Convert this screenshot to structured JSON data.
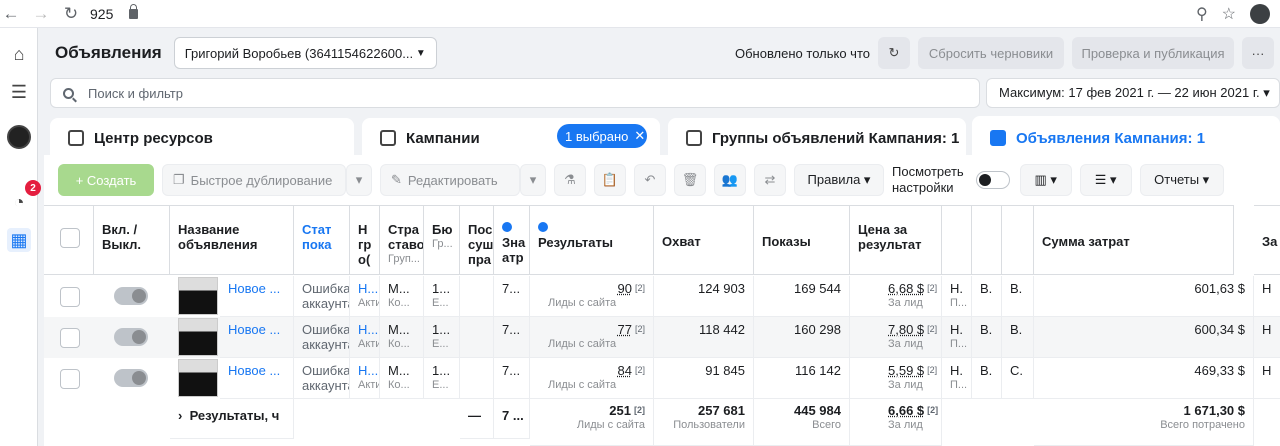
{
  "browser": {
    "url": "925"
  },
  "rail": {
    "notif_count": "2"
  },
  "header": {
    "title": "Объявления",
    "account": "Григорий Воробьев (3641154622600...",
    "updated": "Обновлено только что",
    "reset_label": "Сбросить черновики",
    "publish_label": "Проверка и публикация",
    "more_label": "···"
  },
  "search": {
    "placeholder": "Поиск и фильтр"
  },
  "date_range": "Максимум: 17 фев 2021 г. — 22 июн 2021 г. ▾",
  "tabs": {
    "resources": "Центр ресурсов",
    "campaigns": "Кампании",
    "campaigns_selected": "1 выбрано",
    "adsets": "Группы объявлений Кампания: 1",
    "ads": "Объявления Кампания: 1"
  },
  "toolbar": {
    "create": "+ Создать",
    "duplicate": "Быстрое дублирование",
    "edit": "Редактировать",
    "rules": "Правила ▾",
    "view_settings_1": "Посмотреть",
    "view_settings_2": "настройки",
    "reports": "Отчеты ▾"
  },
  "columns": {
    "onoff_1": "Вкл. /",
    "onoff_2": "Выкл.",
    "name_1": "Название",
    "name_2": "объявления",
    "status_1": "Стат",
    "status_2": "пока",
    "c3_1": "Н",
    "c3_2": "гр",
    "c3_3": "о(",
    "strategy_1": "Стра",
    "strategy_2": "ставо",
    "strategy_sub": "Груп...",
    "budget_1": "Бю",
    "budget_sub": "Гр...",
    "c6_1": "Пос",
    "c6_2": "суш",
    "c6_3": "пра",
    "c7_1": "Зна",
    "c7_2": "атр",
    "results": "Результаты",
    "reach": "Охват",
    "impressions": "Показы",
    "cpr_1": "Цена за",
    "cpr_2": "результат",
    "spent": "Сумма затрат",
    "last": "За"
  },
  "rows": [
    {
      "name": "Новое ...",
      "status": "Ошибка",
      "status2": "аккаунта",
      "c3": "Н...",
      "c3s": "Актив",
      "strat": "М...",
      "strats": "Ко...",
      "budget": "1...",
      "budgets": "Е...",
      "c7": "7...",
      "results": "90",
      "results_sub": "Лиды с сайта",
      "reach": "124 903",
      "impressions": "169 544",
      "cpr": "6,68 $",
      "cpr_sub": "За лид",
      "e1": "Н.",
      "e1s": "П...",
      "e2": "В.",
      "e3": "В.",
      "spent": "601,63 $",
      "z": "Н"
    },
    {
      "name": "Новое ...",
      "status": "Ошибка",
      "status2": "аккаунта",
      "c3": "Н...",
      "c3s": "Актив",
      "strat": "М...",
      "strats": "Ко...",
      "budget": "1...",
      "budgets": "Е...",
      "c7": "7...",
      "results": "77",
      "results_sub": "Лиды с сайта",
      "reach": "118 442",
      "impressions": "160 298",
      "cpr": "7,80 $",
      "cpr_sub": "За лид",
      "e1": "Н.",
      "e1s": "П...",
      "e2": "В.",
      "e3": "В.",
      "spent": "600,34 $",
      "z": "Н"
    },
    {
      "name": "Новое ...",
      "status": "Ошибка",
      "status2": "аккаунта",
      "c3": "Н...",
      "c3s": "Актив",
      "strat": "М...",
      "strats": "Ко...",
      "budget": "1...",
      "budgets": "Е...",
      "c7": "7...",
      "results": "84",
      "results_sub": "Лиды с сайта",
      "reach": "91 845",
      "impressions": "116 142",
      "cpr": "5,59 $",
      "cpr_sub": "За лид",
      "e1": "Н.",
      "e1s": "П...",
      "e2": "В.",
      "e3": "С.",
      "spent": "469,33 $",
      "z": "Н"
    }
  ],
  "totals": {
    "label": "Результаты, ч",
    "c6": "—",
    "c7": "7 ...",
    "results": "251",
    "results_sub": "Лиды с сайта",
    "reach": "257 681",
    "reach_sub": "Пользователи",
    "impressions": "445 984",
    "impressions_sub": "Всего",
    "cpr": "6,66 $",
    "cpr_sub": "За лид",
    "spent": "1 671,30 $",
    "spent_sub": "Всего потрачено"
  },
  "sup_mark": "[2]"
}
